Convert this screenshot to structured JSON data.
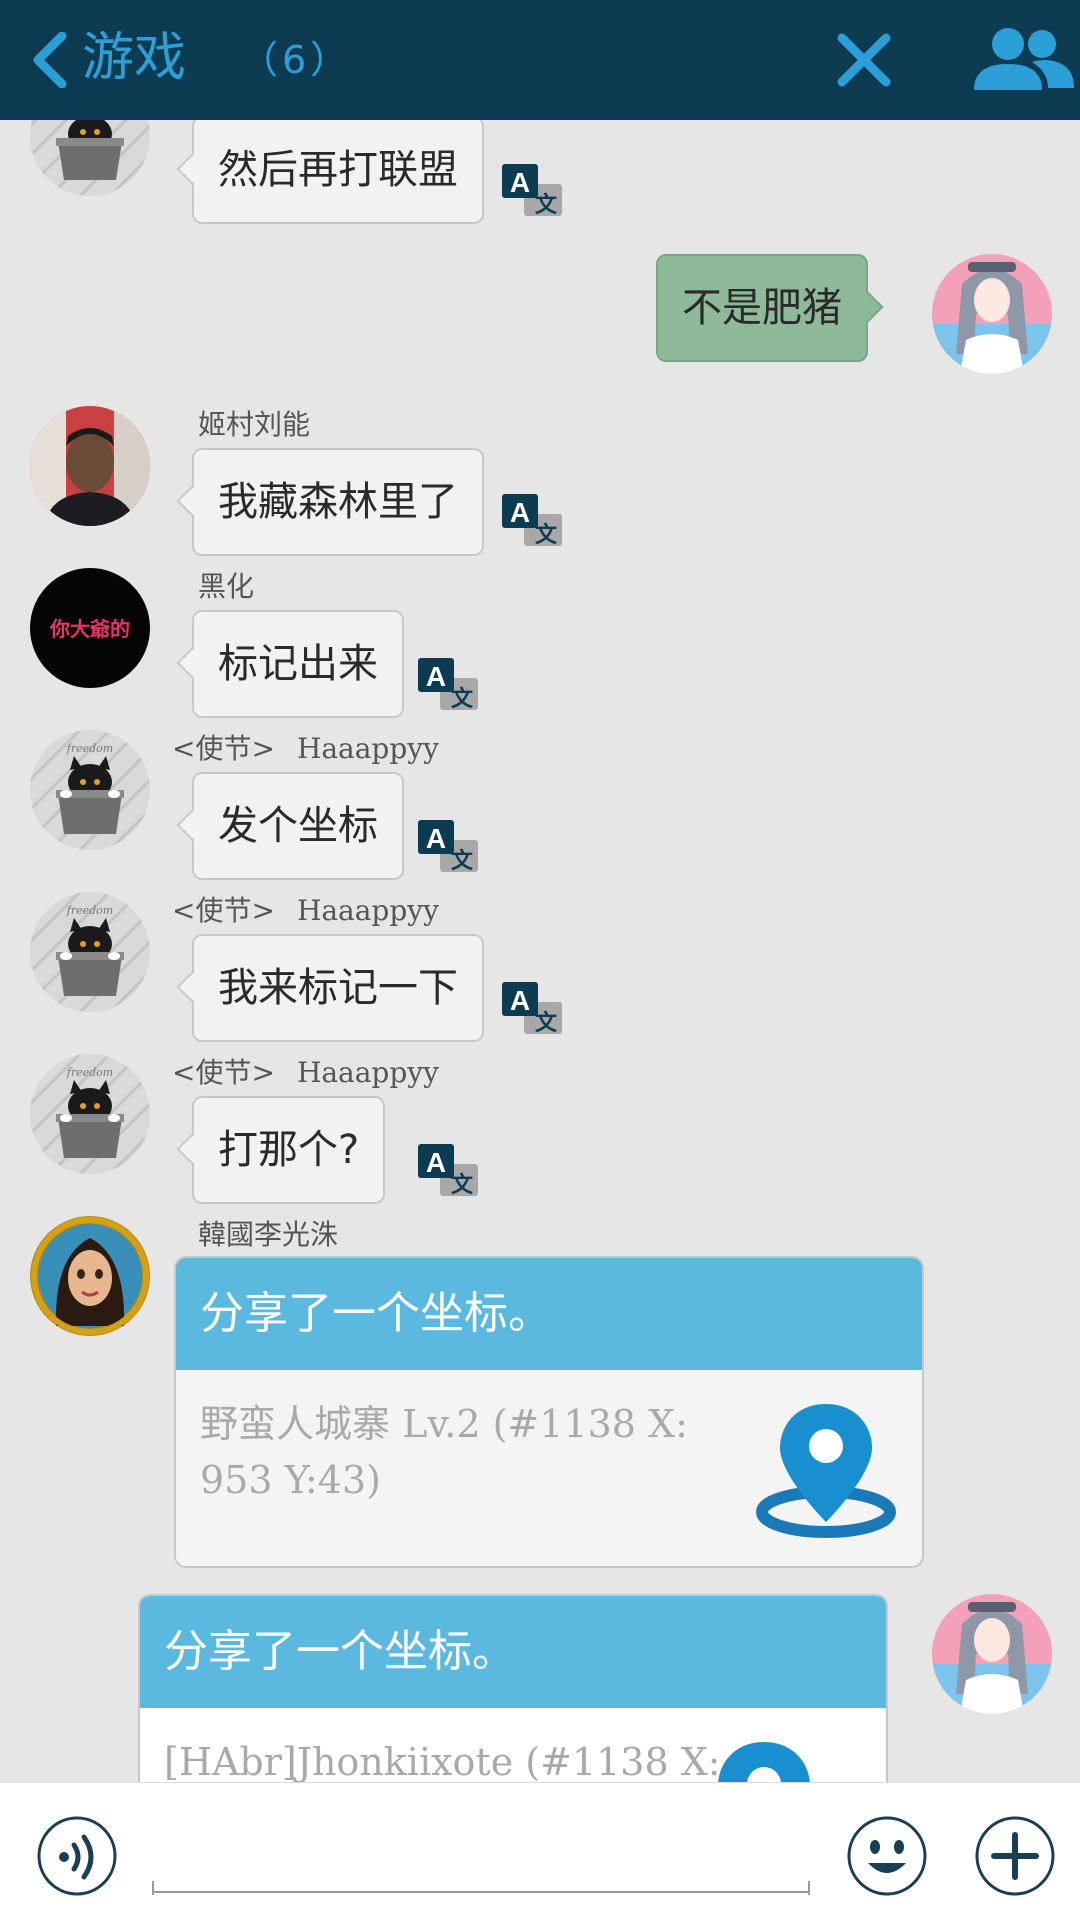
{
  "header": {
    "title": "游戏",
    "member_count": "（6）",
    "colors": {
      "bg": "#0d3c52",
      "accent": "#2c9fd9"
    },
    "icons": [
      "chevron-left-icon",
      "close-icon",
      "group-members-icon"
    ]
  },
  "messages": [
    {
      "type": "text",
      "side": "left",
      "sender": "",
      "text": "然后再打联盟",
      "avatar": "cat-in-basket"
    },
    {
      "type": "text",
      "side": "right",
      "sender": "",
      "text": "不是肥猪",
      "avatar": "anime-girl"
    },
    {
      "type": "text",
      "side": "left",
      "sender": "姬村刘能",
      "text": "我藏森林里了",
      "avatar": "boy-photo"
    },
    {
      "type": "text",
      "side": "left",
      "sender": "黑化",
      "text": "标记出来",
      "avatar": "black-circle-text",
      "avatar_text": "你大爺的"
    },
    {
      "type": "text",
      "side": "left",
      "sender_tag": "<使节>",
      "sender": "Haaappyy",
      "text": "发个坐标",
      "avatar": "cat-in-basket",
      "avatar_text": "freedom"
    },
    {
      "type": "text",
      "side": "left",
      "sender_tag": "<使节>",
      "sender": "Haaappyy",
      "text": "我来标记一下",
      "avatar": "cat-in-basket",
      "avatar_text": "freedom"
    },
    {
      "type": "text",
      "side": "left",
      "sender_tag": "<使节>",
      "sender": "Haaappyy",
      "text": "打那个?",
      "avatar": "cat-in-basket",
      "avatar_text": "freedom"
    },
    {
      "type": "location",
      "side": "left",
      "sender": "韓國李光洙",
      "header": "分享了一个坐标。",
      "body": "野蛮人城寨 Lv.2 (#1138 X: 953 Y:43)",
      "avatar": "cartoon-woman-gold-frame"
    },
    {
      "type": "location",
      "side": "right",
      "sender": "",
      "header": "分享了一个坐标。",
      "body": "[HAbr]Jhonkiixote (#1138 X:",
      "avatar": "anime-girl"
    }
  ],
  "input_bar": {
    "placeholder": "",
    "value": "",
    "icons": [
      "voice-icon",
      "emoji-icon",
      "plus-icon"
    ]
  }
}
